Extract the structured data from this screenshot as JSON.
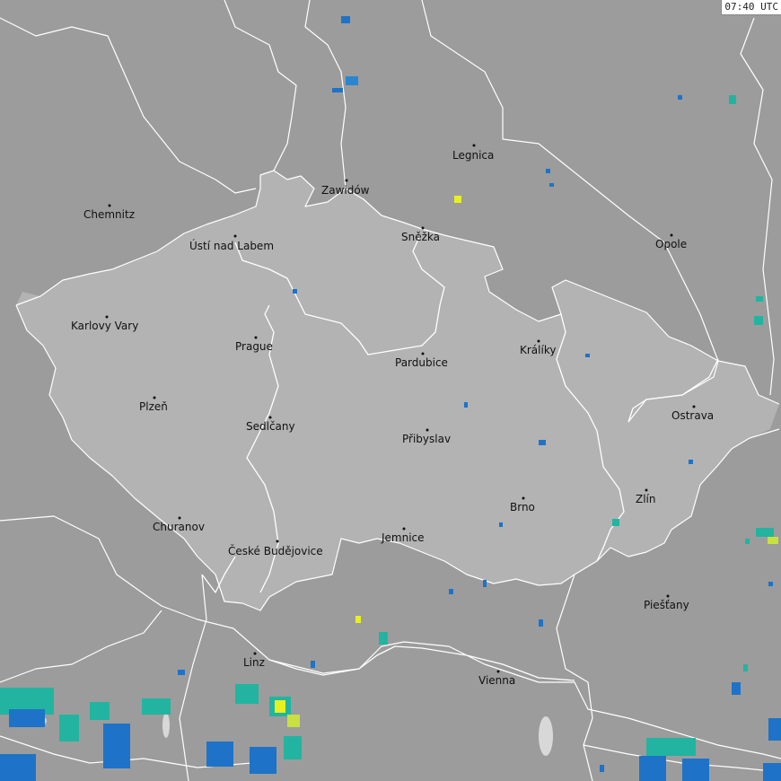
{
  "timestamp": "07:40 UTC",
  "colors": {
    "background": "#9c9c9c",
    "country_fill": "#b3b3b3",
    "border": "#ffffff",
    "label": "#111111",
    "radar_low": "#1e73c8",
    "radar_mid": "#22b4a0",
    "radar_high": "#e8f020"
  },
  "cities": [
    {
      "name": "Chemnitz"
    },
    {
      "name": "Zawidów"
    },
    {
      "name": "Legnica"
    },
    {
      "name": "Ústí nad Labem"
    },
    {
      "name": "Sněžka"
    },
    {
      "name": "Opole"
    },
    {
      "name": "Karlovy Vary"
    },
    {
      "name": "Prague"
    },
    {
      "name": "Pardubice"
    },
    {
      "name": "Králíky"
    },
    {
      "name": "Plzeň"
    },
    {
      "name": "Ostrava"
    },
    {
      "name": "Sedlčany"
    },
    {
      "name": "Přibyslav"
    },
    {
      "name": "Zlín"
    },
    {
      "name": "Brno"
    },
    {
      "name": "Churanov"
    },
    {
      "name": "České Budějovice"
    },
    {
      "name": "Jemnice"
    },
    {
      "name": "Piešťany"
    },
    {
      "name": "Linz"
    },
    {
      "name": "Vienna"
    }
  ]
}
